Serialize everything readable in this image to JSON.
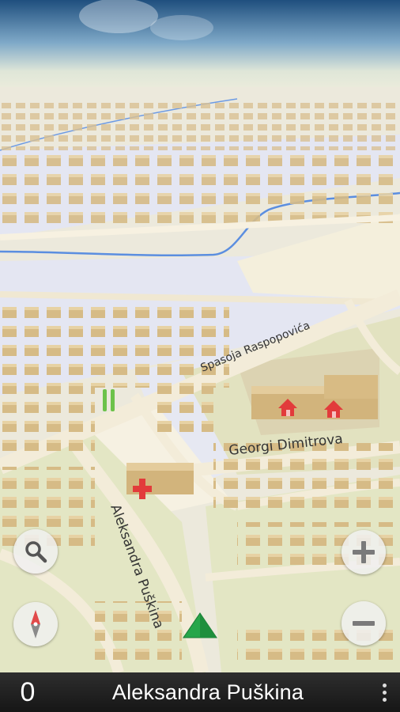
{
  "map": {
    "streets": [
      {
        "id": "spasoje",
        "label": "Spasoja Raspopovića"
      },
      {
        "id": "georgi",
        "label": "Georgi Dimitrova"
      },
      {
        "id": "aleksandra",
        "label": "Aleksandra Puškina"
      }
    ],
    "colors": {
      "park": "#e2e6c6",
      "residential": "#e4e6f0",
      "water": "#5b8ee0",
      "road": "#f2ecdc",
      "building": "#d8bf8c",
      "poi": "#e23b3b",
      "position_arrow": "#27a64a"
    }
  },
  "controls": {
    "search_icon": "search-icon",
    "compass_icon": "compass-icon",
    "zoom_in_icon": "plus-icon",
    "zoom_out_icon": "minus-icon"
  },
  "statusbar": {
    "speed": "0",
    "street_name": "Aleksandra Puškina",
    "menu_icon": "more-vert-icon"
  }
}
